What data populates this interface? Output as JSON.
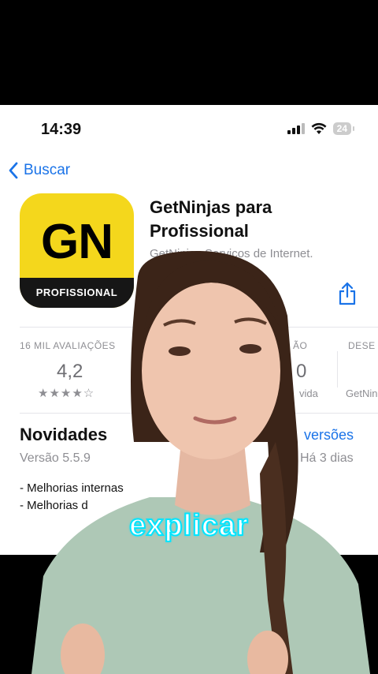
{
  "status": {
    "time": "14:39",
    "battery": "24"
  },
  "nav": {
    "back_label": "Buscar"
  },
  "app": {
    "icon_text": "GN",
    "icon_band": "PROFISSIONAL",
    "title": "GetNinjas para Profissional",
    "developer": "GetNinjas Serviços de Internet."
  },
  "stats": {
    "ratings_label": "16 MIL AVALIAÇÕES",
    "rating_value": "4,2",
    "stars": "★★★★☆",
    "col3_label": "ÃO",
    "col3_value": "0",
    "col3_sub": "vida",
    "col4_label": "DESE",
    "col4_sub": "GetNin"
  },
  "news": {
    "title": "Novidades",
    "link": "versões",
    "version": "Versão 5.5.9",
    "date": "Há 3 dias",
    "notes": [
      "- Melhorias internas",
      "- Melhorias d"
    ]
  },
  "caption": "explicar",
  "colors": {
    "accent": "#1a73e8",
    "icon_yellow": "#f4d71c",
    "caption_stroke": "#00e5ff"
  }
}
